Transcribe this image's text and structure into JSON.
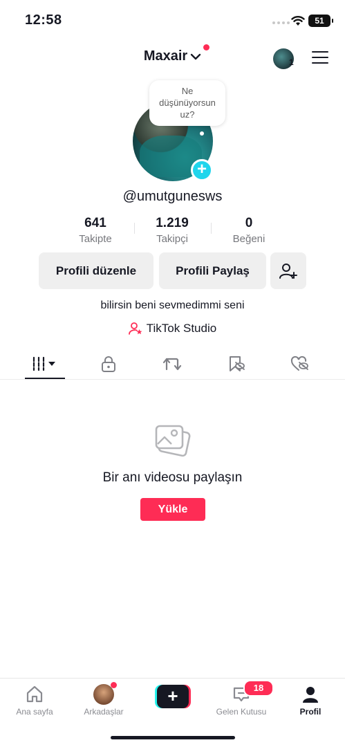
{
  "status_bar": {
    "time": "12:58",
    "battery": "51"
  },
  "header": {
    "username": "Maxair",
    "avatar_count": "1"
  },
  "profile": {
    "thought_bubble": [
      "Ne",
      "düşünüyorsun",
      "uz?"
    ],
    "handle": "@umutgunesws",
    "stats": [
      {
        "value": "641",
        "label": "Takipte"
      },
      {
        "value": "1.219",
        "label": "Takipçi"
      },
      {
        "value": "0",
        "label": "Beğeni"
      }
    ],
    "buttons": {
      "edit": "Profili düzenle",
      "share": "Profili Paylaş"
    },
    "bio": "bilirsin beni sevmedimmi seni",
    "studio_link": "TikTok Studio"
  },
  "tabs": [
    "videos-grid",
    "private",
    "reposts",
    "favorites",
    "liked"
  ],
  "empty_state": {
    "title": "Bir anı videosu paylaşın",
    "button": "Yükle"
  },
  "bottom_nav": {
    "home": "Ana sayfa",
    "friends": "Arkadaşlar",
    "inbox": "Gelen Kutusu",
    "inbox_badge": "18",
    "profile": "Profil"
  },
  "colors": {
    "accent": "#fe2c55",
    "cyan": "#20d5ec",
    "text": "#161823",
    "muted": "#76777c"
  }
}
